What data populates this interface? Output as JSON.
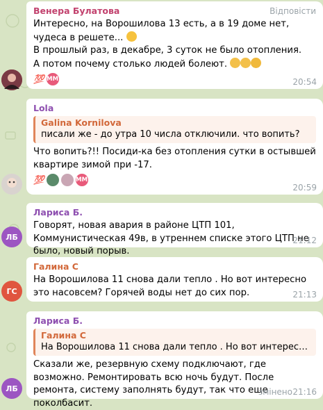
{
  "colors": {
    "background": "#d8e4c4",
    "bubble": "#ffffff",
    "name_venera": "#c2426e",
    "name_lola": "#8e4fb0",
    "name_larisa": "#8e4fb0",
    "name_galina": "#d2683a",
    "avatar_lb": "#9c55c2",
    "avatar_gs": "#e0553f",
    "timestamp": "#9aa3a8"
  },
  "messages": [
    {
      "sender": "Венера Булатова",
      "reply_label": "Відповісти",
      "text": "Интересно, на Ворошилова 13 есть, а в 19 доме нет, чудеса в решете...",
      "text2": "В прошлый раз, в декабре, 3 суток не было отопления.\nА потом почему столько людей болеют.",
      "reactions": [
        "💯",
        "MM"
      ],
      "time": "20:54",
      "emoji_icons": [
        "thinking-face-icon",
        "clapping-hands-icon",
        "thumbs-up-icon"
      ]
    },
    {
      "sender": "Lola",
      "quote_name": "Galina Kornilova",
      "quote_text": "писали же - до утра 10 числа отключили. что вопить?",
      "text": "Что вопить?!! Посиди-ка без отопления сутки в остывшей квартире зимой при -17.",
      "reactions": [
        "💯",
        "MM"
      ],
      "time": "20:59"
    },
    {
      "sender": "Лариса Б.",
      "avatar": "ЛБ",
      "text": "Говорят, новая авария в районе ЦТП 101, Коммунистическая 49в, в утреннем списке этого ЦТП не было, новый порыв.",
      "time": "21:12"
    },
    {
      "sender": "Галина С",
      "avatar": "ГС",
      "text": "На Ворошилова 11 снова дали тепло . Но вот интересно это насовсем? Горячей воды нет до сих пор.",
      "time": "21:13"
    },
    {
      "sender": "Лариса Б.",
      "avatar": "ЛБ",
      "quote_name": "Галина С",
      "quote_text": "На Ворошилова 11 снова дали тепло . Но вот интересно это н...",
      "text": "Сказали же, резервную схему подключают, где возможно. Ремонтировать всю ночь будут. После ремонта, систему заполнять будут, так что еще поколбасит.",
      "edited": "змінено",
      "time": "21:16"
    }
  ]
}
